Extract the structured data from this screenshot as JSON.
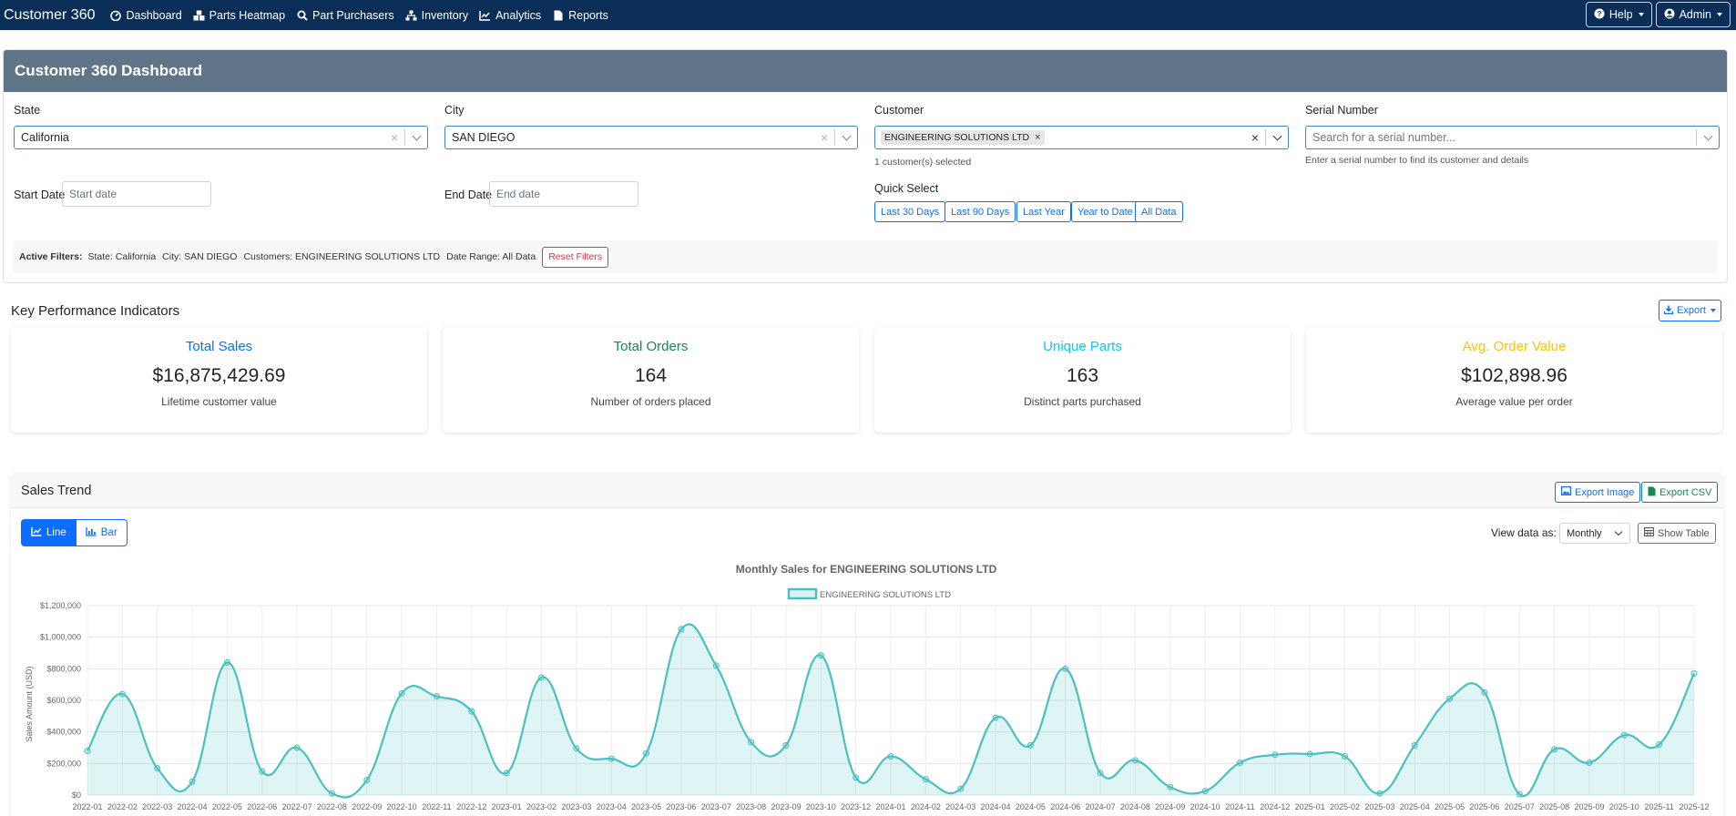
{
  "navbar": {
    "brand": "Customer 360",
    "items": [
      {
        "label": "Dashboard",
        "icon": "dashboard-icon"
      },
      {
        "label": "Parts Heatmap",
        "icon": "cubes-icon"
      },
      {
        "label": "Part Purchasers",
        "icon": "search-icon"
      },
      {
        "label": "Inventory",
        "icon": "sitemap-icon"
      },
      {
        "label": "Analytics",
        "icon": "line-chart-icon"
      },
      {
        "label": "Reports",
        "icon": "file-icon"
      }
    ],
    "help_label": "Help",
    "admin_label": "Admin"
  },
  "dashboard": {
    "title": "Customer 360 Dashboard",
    "state": {
      "label": "State",
      "value": "California"
    },
    "city": {
      "label": "City",
      "value": "SAN DIEGO"
    },
    "customer": {
      "label": "Customer",
      "chip": "ENGINEERING SOLUTIONS LTD",
      "help": "1 customer(s) selected"
    },
    "serial": {
      "label": "Serial Number",
      "placeholder": "Search for a serial number...",
      "help": "Enter a serial number to find its customer and details"
    },
    "start_date": {
      "label": "Start Date",
      "placeholder": "Start date"
    },
    "end_date": {
      "label": "End Date",
      "placeholder": "End date"
    },
    "quick_select": {
      "label": "Quick Select",
      "buttons": [
        "Last 30 Days",
        "Last 90 Days",
        "Last Year",
        "Year to Date",
        "All Data"
      ]
    },
    "active_filters": {
      "label": "Active Filters:",
      "state": "State: California",
      "city": "City: SAN DIEGO",
      "customers": "Customers: ENGINEERING SOLUTIONS LTD",
      "date_range": "Date Range: All Data",
      "reset_label": "Reset Filters"
    }
  },
  "kpi": {
    "title": "Key Performance Indicators",
    "export_label": "Export",
    "cards": [
      {
        "title": "Total Sales",
        "value": "$16,875,429.69",
        "subtitle": "Lifetime customer value",
        "color": "#0d6efd"
      },
      {
        "title": "Total Orders",
        "value": "164",
        "subtitle": "Number of orders placed",
        "color": "#198754"
      },
      {
        "title": "Unique Parts",
        "value": "163",
        "subtitle": "Distinct parts purchased",
        "color": "#0dcaf0"
      },
      {
        "title": "Avg. Order Value",
        "value": "$102,898.96",
        "subtitle": "Average value per order",
        "color": "#ffc107"
      }
    ]
  },
  "sales_trend": {
    "title": "Sales Trend",
    "export_image_label": "Export Image",
    "export_csv_label": "Export CSV",
    "line_label": "Line",
    "bar_label": "Bar",
    "view_label": "View data as:",
    "view_value": "Monthly",
    "show_table_label": "Show Table"
  },
  "chart_data": {
    "type": "area",
    "title": "Monthly Sales for ENGINEERING SOLUTIONS LTD",
    "ylabel": "Sales Amount (USD)",
    "xlabel": "",
    "ylim": [
      0,
      1200000
    ],
    "yticks": [
      "$0",
      "$200,000",
      "$400,000",
      "$600,000",
      "$800,000",
      "$1,000,000",
      "$1,200,000"
    ],
    "line_color": "#4bc0c0",
    "fill_color": "#4bc0c0",
    "grid": true,
    "legend": "top-center",
    "categories": [
      "2022-01",
      "2022-02",
      "2022-03",
      "2022-04",
      "2022-05",
      "2022-06",
      "2022-07",
      "2022-08",
      "2022-09",
      "2022-10",
      "2022-11",
      "2022-12",
      "2023-01",
      "2023-02",
      "2023-03",
      "2023-04",
      "2023-05",
      "2023-06",
      "2023-07",
      "2023-08",
      "2023-09",
      "2023-10",
      "2023-12",
      "2024-01",
      "2024-02",
      "2024-03",
      "2024-04",
      "2024-05",
      "2024-06",
      "2024-07",
      "2024-08",
      "2024-09",
      "2024-10",
      "2024-11",
      "2024-12",
      "2025-01",
      "2025-02",
      "2025-03",
      "2025-04",
      "2025-05",
      "2025-06",
      "2025-07",
      "2025-08",
      "2025-09",
      "2025-10",
      "2025-11",
      "2025-12"
    ],
    "series": [
      {
        "name": "ENGINEERING SOLUTIONS LTD",
        "values": [
          280000,
          640000,
          170000,
          85000,
          840000,
          150000,
          300000,
          10000,
          95000,
          645000,
          625000,
          530000,
          140000,
          745000,
          295000,
          230000,
          265000,
          1050000,
          820000,
          335000,
          315000,
          885000,
          110000,
          245000,
          100000,
          40000,
          490000,
          315000,
          800000,
          140000,
          220000,
          50000,
          25000,
          205000,
          255000,
          260000,
          245000,
          10000,
          315000,
          610000,
          650000,
          5000,
          290000,
          205000,
          380000,
          320000,
          770000
        ]
      }
    ]
  }
}
